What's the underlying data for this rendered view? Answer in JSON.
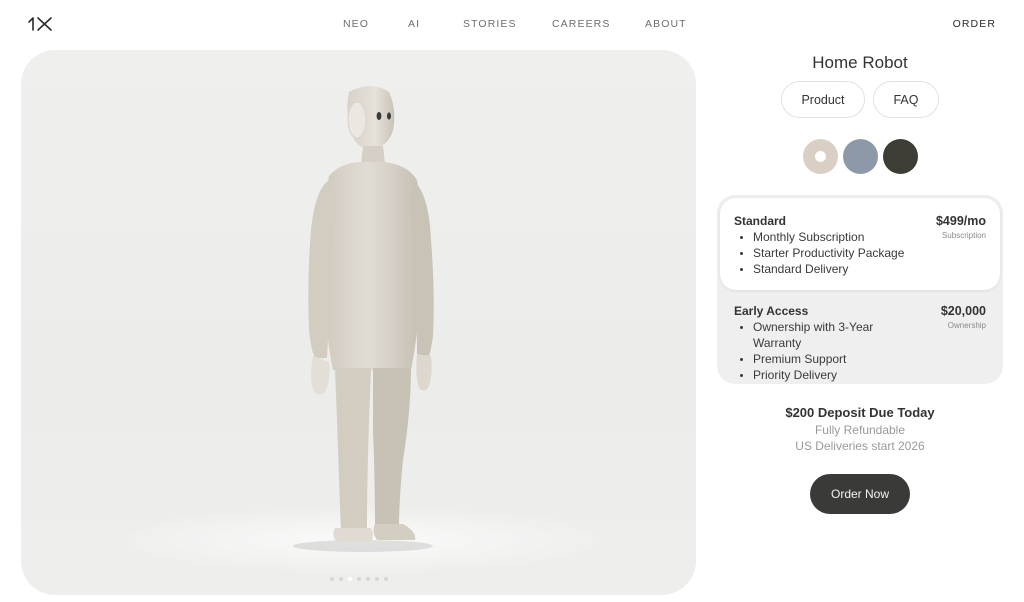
{
  "brand": {
    "logo_text": "1X",
    "logo_icon": "1x-logo-icon"
  },
  "nav": {
    "items": [
      {
        "label": "NEO"
      },
      {
        "label": "AI"
      },
      {
        "label": "STORIES"
      },
      {
        "label": "CAREERS"
      },
      {
        "label": "ABOUT"
      }
    ],
    "order_label": "ORDER"
  },
  "stage": {
    "image": "humanoid-robot-neo",
    "carousel": {
      "count": 7,
      "active_index": 2
    }
  },
  "product": {
    "title": "Home Robot",
    "tabs": [
      {
        "label": "Product"
      },
      {
        "label": "FAQ"
      }
    ],
    "colors": [
      {
        "name": "beige",
        "hex": "#d9cfc4",
        "selected": true
      },
      {
        "name": "blue-grey",
        "hex": "#8d99a8",
        "selected": false
      },
      {
        "name": "dark-olive",
        "hex": "#3d3d35",
        "selected": false
      }
    ]
  },
  "plans": [
    {
      "name": "Standard",
      "price": "$499/mo",
      "type": "Subscription",
      "selected": true,
      "features": [
        "Monthly Subscription",
        "Starter Productivity Package",
        "Standard Delivery"
      ]
    },
    {
      "name": "Early Access",
      "price": "$20,000",
      "type": "Ownership",
      "selected": false,
      "features": [
        "Ownership with 3-Year Warranty",
        "Premium Support",
        "Priority Delivery"
      ]
    }
  ],
  "deposit": {
    "title": "$200 Deposit Due Today",
    "line1": "Fully Refundable",
    "line2": "US Deliveries start 2026"
  },
  "cta": {
    "order_now": "Order Now"
  }
}
